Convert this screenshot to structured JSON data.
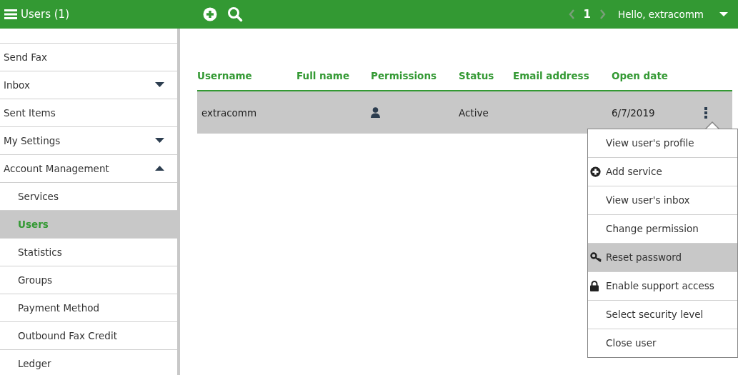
{
  "topbar": {
    "title": "Users (1)",
    "pager": {
      "page": "1",
      "prev_disabled": true,
      "next_disabled": true
    },
    "greeting": "Hello, extracomm"
  },
  "sidebar": {
    "items": [
      {
        "label": "Send Fax",
        "kind": "top",
        "selected": false
      },
      {
        "label": "Inbox",
        "kind": "top",
        "selected": false,
        "expanded": false
      },
      {
        "label": "Sent Items",
        "kind": "top",
        "selected": false
      },
      {
        "label": "My Settings",
        "kind": "top",
        "selected": false,
        "expanded": false
      },
      {
        "label": "Account Management",
        "kind": "top",
        "selected": false,
        "expanded": true
      },
      {
        "label": "Services",
        "kind": "sub",
        "selected": false
      },
      {
        "label": "Users",
        "kind": "sub",
        "selected": true
      },
      {
        "label": "Statistics",
        "kind": "sub",
        "selected": false
      },
      {
        "label": "Groups",
        "kind": "sub",
        "selected": false
      },
      {
        "label": "Payment Method",
        "kind": "sub",
        "selected": false
      },
      {
        "label": "Outbound Fax Credit",
        "kind": "sub",
        "selected": false
      },
      {
        "label": "Ledger",
        "kind": "sub",
        "selected": false
      }
    ]
  },
  "table": {
    "columns": [
      "Username",
      "Full name",
      "Permissions",
      "Status",
      "Email address",
      "Open date"
    ],
    "rows": [
      {
        "username": "extracomm",
        "permissions_icon": true,
        "status": "Active",
        "open_date": "6/7/2019",
        "selected": true
      }
    ]
  },
  "menu": {
    "items": [
      {
        "label": "View user's profile",
        "kind": "plain",
        "selected": false
      },
      {
        "label": "Add service",
        "kind": "add",
        "selected": false
      },
      {
        "label": "View user's inbox",
        "kind": "plain",
        "selected": false
      },
      {
        "label": "Change permission",
        "kind": "plain",
        "selected": false
      },
      {
        "label": "Reset password",
        "kind": "key",
        "selected": true
      },
      {
        "label": "Enable support access",
        "kind": "lock",
        "selected": false
      },
      {
        "label": "Select security level",
        "kind": "plain",
        "selected": false
      },
      {
        "label": "Close user",
        "kind": "plain",
        "selected": false
      }
    ]
  }
}
